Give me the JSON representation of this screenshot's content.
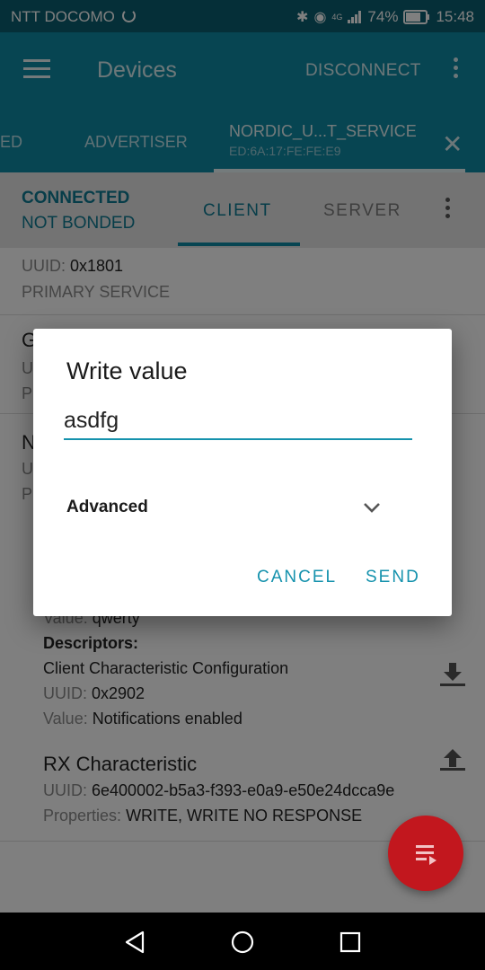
{
  "status_bar": {
    "carrier": "NTT DOCOMO",
    "battery": "74%",
    "time": "15:48",
    "network": "4G"
  },
  "app_bar": {
    "title": "Devices",
    "disconnect_label": "DISCONNECT"
  },
  "device_tabs": {
    "partial_tab": "ED",
    "advertiser_tab": "ADVERTISER",
    "active_tab": {
      "name": "NORDIC_U...T_SERVICE",
      "address": "ED:6A:17:FE:FE:E9"
    }
  },
  "connection": {
    "state": "CONNECTED",
    "bond": "NOT BONDED",
    "client_tab": "CLIENT",
    "server_tab": "SERVER"
  },
  "list": {
    "service1": {
      "uuid_label": "UUID:",
      "uuid": "0x1801",
      "type": "PRIMARY SERVICE"
    },
    "service2": {
      "title": "G",
      "uuid_partial": "U",
      "type_partial": "P"
    },
    "service3": {
      "title": "N",
      "uuid_partial": "U",
      "type_partial": "P"
    },
    "tx_char": {
      "value_label": "Value:",
      "value": "qwerty",
      "descriptors_label": "Descriptors:",
      "descriptor_name": "Client Characteristic Configuration",
      "descriptor_uuid_label": "UUID:",
      "descriptor_uuid": "0x2902",
      "descriptor_value_label": "Value:",
      "descriptor_value": "Notifications enabled"
    },
    "rx_char": {
      "title": "RX Characteristic",
      "uuid_label": "UUID:",
      "uuid": "6e400002-b5a3-f393-e0a9-e50e24dcca9e",
      "properties_label": "Properties:",
      "properties": "WRITE, WRITE NO RESPONSE"
    }
  },
  "dialog": {
    "title": "Write value",
    "input_value": "asdfg",
    "advanced_label": "Advanced",
    "cancel_label": "CANCEL",
    "send_label": "SEND"
  },
  "colors": {
    "app_bar": "#0e8ba4",
    "status_bar": "#0b5f70",
    "accent": "#1592ad",
    "fab": "#c2171e"
  }
}
